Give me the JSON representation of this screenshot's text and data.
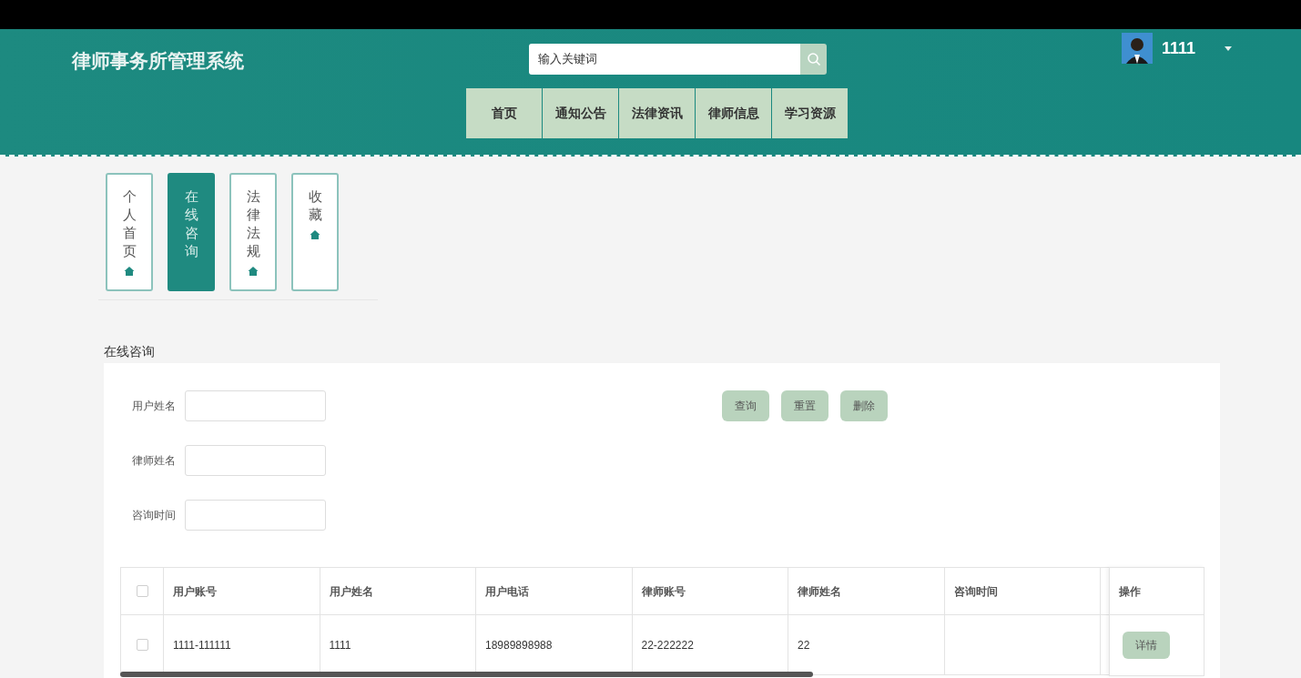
{
  "header": {
    "title": "律师事务所管理系统",
    "search": {
      "placeholder": "输入关键词"
    },
    "nav": [
      "首页",
      "通知公告",
      "法律资讯",
      "律师信息",
      "学习资源"
    ],
    "user": {
      "name": "1111"
    }
  },
  "side_tabs": [
    {
      "label": "个人首页",
      "selected": false
    },
    {
      "label": "在线咨询",
      "selected": true
    },
    {
      "label": "法律法规",
      "selected": false
    },
    {
      "label": "收藏",
      "selected": false
    }
  ],
  "section_title": "在线咨询",
  "filters": [
    {
      "label": "用户姓名"
    },
    {
      "label": "律师姓名"
    },
    {
      "label": "咨询时间"
    }
  ],
  "buttons": [
    "查询",
    "重置",
    "删除"
  ],
  "table": {
    "header_checked": false,
    "columns": [
      "用户账号",
      "用户姓名",
      "用户电话",
      "律师账号",
      "律师姓名",
      "咨询时间"
    ],
    "action_column": "操作",
    "rows": [
      {
        "checked": false,
        "cells": [
          "1111-111111",
          "1111",
          "18989898988",
          "22-222222",
          "22",
          ""
        ],
        "action": "详情"
      }
    ]
  }
}
